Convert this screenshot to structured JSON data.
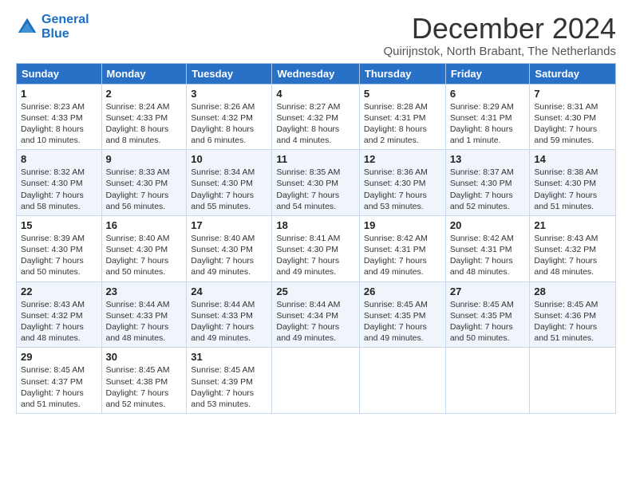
{
  "logo": {
    "line1": "General",
    "line2": "Blue"
  },
  "title": "December 2024",
  "subtitle": "Quirijnstok, North Brabant, The Netherlands",
  "weekdays": [
    "Sunday",
    "Monday",
    "Tuesday",
    "Wednesday",
    "Thursday",
    "Friday",
    "Saturday"
  ],
  "weeks": [
    [
      {
        "day": "1",
        "info": "Sunrise: 8:23 AM\nSunset: 4:33 PM\nDaylight: 8 hours\nand 10 minutes."
      },
      {
        "day": "2",
        "info": "Sunrise: 8:24 AM\nSunset: 4:33 PM\nDaylight: 8 hours\nand 8 minutes."
      },
      {
        "day": "3",
        "info": "Sunrise: 8:26 AM\nSunset: 4:32 PM\nDaylight: 8 hours\nand 6 minutes."
      },
      {
        "day": "4",
        "info": "Sunrise: 8:27 AM\nSunset: 4:32 PM\nDaylight: 8 hours\nand 4 minutes."
      },
      {
        "day": "5",
        "info": "Sunrise: 8:28 AM\nSunset: 4:31 PM\nDaylight: 8 hours\nand 2 minutes."
      },
      {
        "day": "6",
        "info": "Sunrise: 8:29 AM\nSunset: 4:31 PM\nDaylight: 8 hours\nand 1 minute."
      },
      {
        "day": "7",
        "info": "Sunrise: 8:31 AM\nSunset: 4:30 PM\nDaylight: 7 hours\nand 59 minutes."
      }
    ],
    [
      {
        "day": "8",
        "info": "Sunrise: 8:32 AM\nSunset: 4:30 PM\nDaylight: 7 hours\nand 58 minutes."
      },
      {
        "day": "9",
        "info": "Sunrise: 8:33 AM\nSunset: 4:30 PM\nDaylight: 7 hours\nand 56 minutes."
      },
      {
        "day": "10",
        "info": "Sunrise: 8:34 AM\nSunset: 4:30 PM\nDaylight: 7 hours\nand 55 minutes."
      },
      {
        "day": "11",
        "info": "Sunrise: 8:35 AM\nSunset: 4:30 PM\nDaylight: 7 hours\nand 54 minutes."
      },
      {
        "day": "12",
        "info": "Sunrise: 8:36 AM\nSunset: 4:30 PM\nDaylight: 7 hours\nand 53 minutes."
      },
      {
        "day": "13",
        "info": "Sunrise: 8:37 AM\nSunset: 4:30 PM\nDaylight: 7 hours\nand 52 minutes."
      },
      {
        "day": "14",
        "info": "Sunrise: 8:38 AM\nSunset: 4:30 PM\nDaylight: 7 hours\nand 51 minutes."
      }
    ],
    [
      {
        "day": "15",
        "info": "Sunrise: 8:39 AM\nSunset: 4:30 PM\nDaylight: 7 hours\nand 50 minutes."
      },
      {
        "day": "16",
        "info": "Sunrise: 8:40 AM\nSunset: 4:30 PM\nDaylight: 7 hours\nand 50 minutes."
      },
      {
        "day": "17",
        "info": "Sunrise: 8:40 AM\nSunset: 4:30 PM\nDaylight: 7 hours\nand 49 minutes."
      },
      {
        "day": "18",
        "info": "Sunrise: 8:41 AM\nSunset: 4:30 PM\nDaylight: 7 hours\nand 49 minutes."
      },
      {
        "day": "19",
        "info": "Sunrise: 8:42 AM\nSunset: 4:31 PM\nDaylight: 7 hours\nand 49 minutes."
      },
      {
        "day": "20",
        "info": "Sunrise: 8:42 AM\nSunset: 4:31 PM\nDaylight: 7 hours\nand 48 minutes."
      },
      {
        "day": "21",
        "info": "Sunrise: 8:43 AM\nSunset: 4:32 PM\nDaylight: 7 hours\nand 48 minutes."
      }
    ],
    [
      {
        "day": "22",
        "info": "Sunrise: 8:43 AM\nSunset: 4:32 PM\nDaylight: 7 hours\nand 48 minutes."
      },
      {
        "day": "23",
        "info": "Sunrise: 8:44 AM\nSunset: 4:33 PM\nDaylight: 7 hours\nand 48 minutes."
      },
      {
        "day": "24",
        "info": "Sunrise: 8:44 AM\nSunset: 4:33 PM\nDaylight: 7 hours\nand 49 minutes."
      },
      {
        "day": "25",
        "info": "Sunrise: 8:44 AM\nSunset: 4:34 PM\nDaylight: 7 hours\nand 49 minutes."
      },
      {
        "day": "26",
        "info": "Sunrise: 8:45 AM\nSunset: 4:35 PM\nDaylight: 7 hours\nand 49 minutes."
      },
      {
        "day": "27",
        "info": "Sunrise: 8:45 AM\nSunset: 4:35 PM\nDaylight: 7 hours\nand 50 minutes."
      },
      {
        "day": "28",
        "info": "Sunrise: 8:45 AM\nSunset: 4:36 PM\nDaylight: 7 hours\nand 51 minutes."
      }
    ],
    [
      {
        "day": "29",
        "info": "Sunrise: 8:45 AM\nSunset: 4:37 PM\nDaylight: 7 hours\nand 51 minutes."
      },
      {
        "day": "30",
        "info": "Sunrise: 8:45 AM\nSunset: 4:38 PM\nDaylight: 7 hours\nand 52 minutes."
      },
      {
        "day": "31",
        "info": "Sunrise: 8:45 AM\nSunset: 4:39 PM\nDaylight: 7 hours\nand 53 minutes."
      },
      {
        "day": "",
        "info": ""
      },
      {
        "day": "",
        "info": ""
      },
      {
        "day": "",
        "info": ""
      },
      {
        "day": "",
        "info": ""
      }
    ]
  ]
}
